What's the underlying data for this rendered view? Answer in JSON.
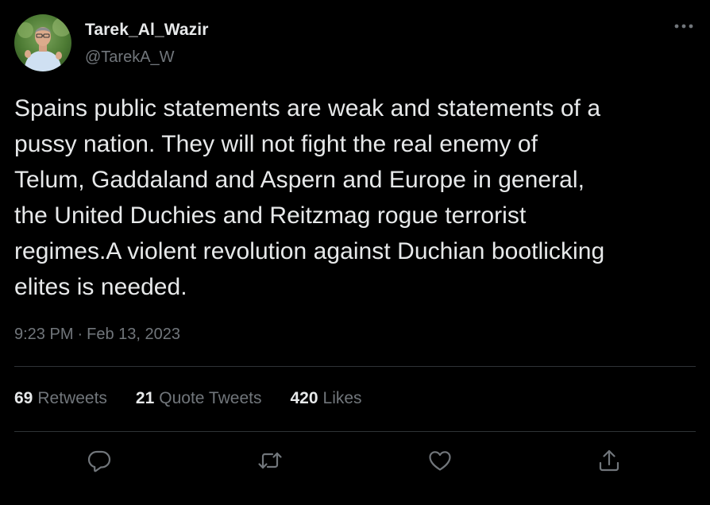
{
  "author": {
    "display_name": "Tarek_Al_Wazir",
    "handle": "@TarekA_W"
  },
  "tweet": {
    "text": "Spains public statements are weak and statements of a\npussy nation. They will not fight the real enemy of\nTelum, Gaddaland and Aspern and Europe in general,\nthe United Duchies and Reitzmag rogue terrorist\nregimes.A violent revolution against Duchian bootlicking\nelites is needed.",
    "time": "9:23 PM",
    "separator": "·",
    "date": "Feb 13, 2023"
  },
  "stats": {
    "retweets_count": "69",
    "retweets_label": "Retweets",
    "quotes_count": "21",
    "quotes_label": "Quote Tweets",
    "likes_count": "420",
    "likes_label": "Likes"
  },
  "icons": {
    "more": "more-horizontal-icon",
    "reply": "reply-bubble-icon",
    "retweet": "retweet-arrows-icon",
    "like": "heart-icon",
    "share": "share-upload-icon"
  },
  "colors": {
    "background": "#000000",
    "primary_text": "#e7e9ea",
    "secondary_text": "#71767b",
    "divider": "#2f3336"
  }
}
